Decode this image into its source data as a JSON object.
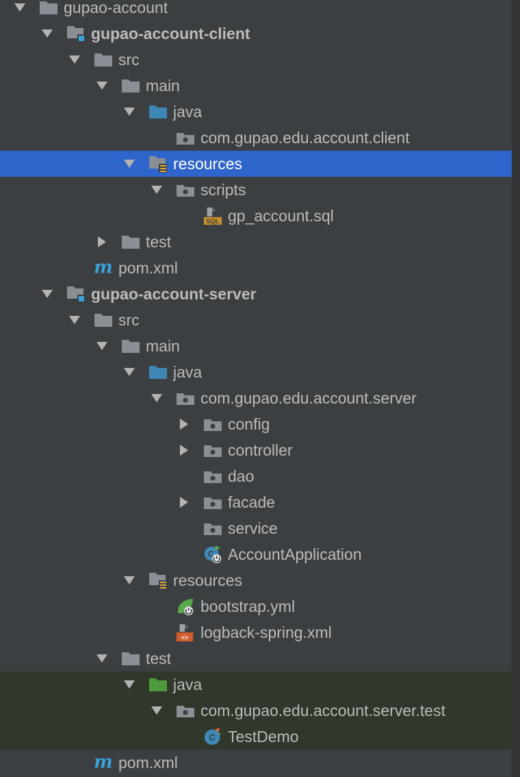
{
  "tree": [
    {
      "label": "gupao-account",
      "arrow": "down",
      "icon": "folder",
      "indent": 0
    },
    {
      "label": "gupao-account-client",
      "arrow": "down",
      "icon": "module",
      "indent": 1,
      "bold": true
    },
    {
      "label": "src",
      "arrow": "down",
      "icon": "folder",
      "indent": 2
    },
    {
      "label": "main",
      "arrow": "down",
      "icon": "folder",
      "indent": 3
    },
    {
      "label": "java",
      "arrow": "down",
      "icon": "source-folder",
      "indent": 4
    },
    {
      "label": "com.gupao.edu.account.client",
      "arrow": "none",
      "icon": "package",
      "indent": 5
    },
    {
      "label": "resources",
      "arrow": "down",
      "icon": "resources-folder",
      "indent": 4,
      "selected": true
    },
    {
      "label": "scripts",
      "arrow": "down",
      "icon": "package",
      "indent": 5
    },
    {
      "label": "gp_account.sql",
      "arrow": "none",
      "icon": "sql-file",
      "indent": 6
    },
    {
      "label": "test",
      "arrow": "right",
      "icon": "folder",
      "indent": 3
    },
    {
      "label": "pom.xml",
      "arrow": "none",
      "icon": "maven",
      "indent": 2
    },
    {
      "label": "gupao-account-server",
      "arrow": "down",
      "icon": "module",
      "indent": 1,
      "bold": true
    },
    {
      "label": "src",
      "arrow": "down",
      "icon": "folder",
      "indent": 2
    },
    {
      "label": "main",
      "arrow": "down",
      "icon": "folder",
      "indent": 3
    },
    {
      "label": "java",
      "arrow": "down",
      "icon": "source-folder",
      "indent": 4
    },
    {
      "label": "com.gupao.edu.account.server",
      "arrow": "down",
      "icon": "package",
      "indent": 5
    },
    {
      "label": "config",
      "arrow": "right",
      "icon": "package",
      "indent": 6
    },
    {
      "label": "controller",
      "arrow": "right",
      "icon": "package",
      "indent": 6
    },
    {
      "label": "dao",
      "arrow": "none",
      "icon": "package",
      "indent": 6
    },
    {
      "label": "facade",
      "arrow": "right",
      "icon": "package",
      "indent": 6
    },
    {
      "label": "service",
      "arrow": "none",
      "icon": "package",
      "indent": 6
    },
    {
      "label": "AccountApplication",
      "arrow": "none",
      "icon": "spring-boot-class",
      "indent": 6
    },
    {
      "label": "resources",
      "arrow": "down",
      "icon": "resources-folder",
      "indent": 4
    },
    {
      "label": "bootstrap.yml",
      "arrow": "none",
      "icon": "spring-leaf",
      "indent": 5
    },
    {
      "label": "logback-spring.xml",
      "arrow": "none",
      "icon": "xml-file",
      "indent": 5
    },
    {
      "label": "test",
      "arrow": "down",
      "icon": "folder",
      "indent": 3
    },
    {
      "label": "java",
      "arrow": "down",
      "icon": "test-source-folder",
      "indent": 4,
      "test": true
    },
    {
      "label": "com.gupao.edu.account.server.test",
      "arrow": "down",
      "icon": "package",
      "indent": 5,
      "test": true
    },
    {
      "label": "TestDemo",
      "arrow": "none",
      "icon": "test-class",
      "indent": 6,
      "test": true
    },
    {
      "label": "pom.xml",
      "arrow": "none",
      "icon": "maven",
      "indent": 2
    }
  ],
  "colors": {
    "background": "#3c3f41",
    "selection": "#2f65ca",
    "test_background": "#2f382b",
    "text": "#bbbbbb",
    "folder": "#8a8f95",
    "source_folder": "#3d87b4",
    "test_source_folder": "#4e9a3c"
  }
}
